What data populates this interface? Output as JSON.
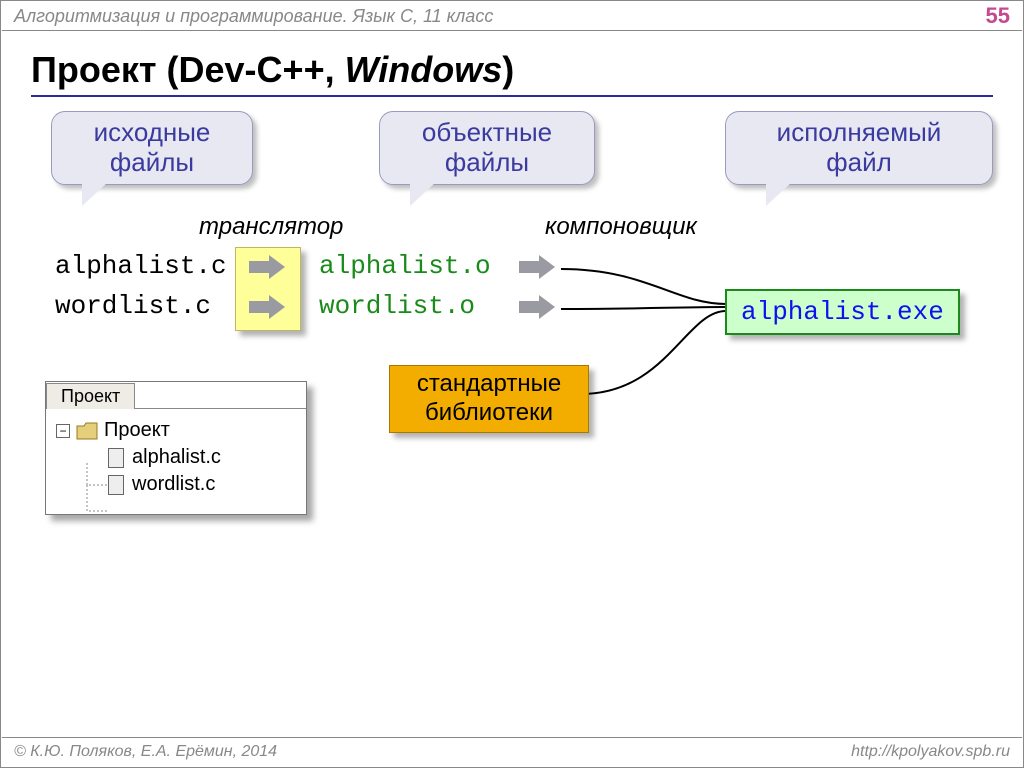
{
  "header": {
    "course": "Алгоритмизация и программирование. Язык С, 11 класс",
    "page": "55"
  },
  "title": {
    "pre": "Проект (Dev-C++, ",
    "italic": "Windows",
    "post": ")"
  },
  "callouts": {
    "source_l1": "исходные",
    "source_l2": "файлы",
    "object_l1": "объектные",
    "object_l2": "файлы",
    "exe_l1": "исполняемый",
    "exe_l2": "файл"
  },
  "labels": {
    "translator": "транслятор",
    "linker": "компоновщик"
  },
  "files": {
    "src1": "alphalist.c",
    "src2": "wordlist.c",
    "obj1": "alphalist.o",
    "obj2": "wordlist.o",
    "exe": "alphalist.exe"
  },
  "stdlibs": {
    "l1": "стандартные",
    "l2": "библиотеки"
  },
  "project_panel": {
    "tab": "Проект",
    "root": "Проект",
    "file1": "alphalist.c",
    "file2": "wordlist.c"
  },
  "footer": {
    "left": "© К.Ю. Поляков, Е.А. Ерёмин, 2014",
    "right": "http://kpolyakov.spb.ru"
  }
}
